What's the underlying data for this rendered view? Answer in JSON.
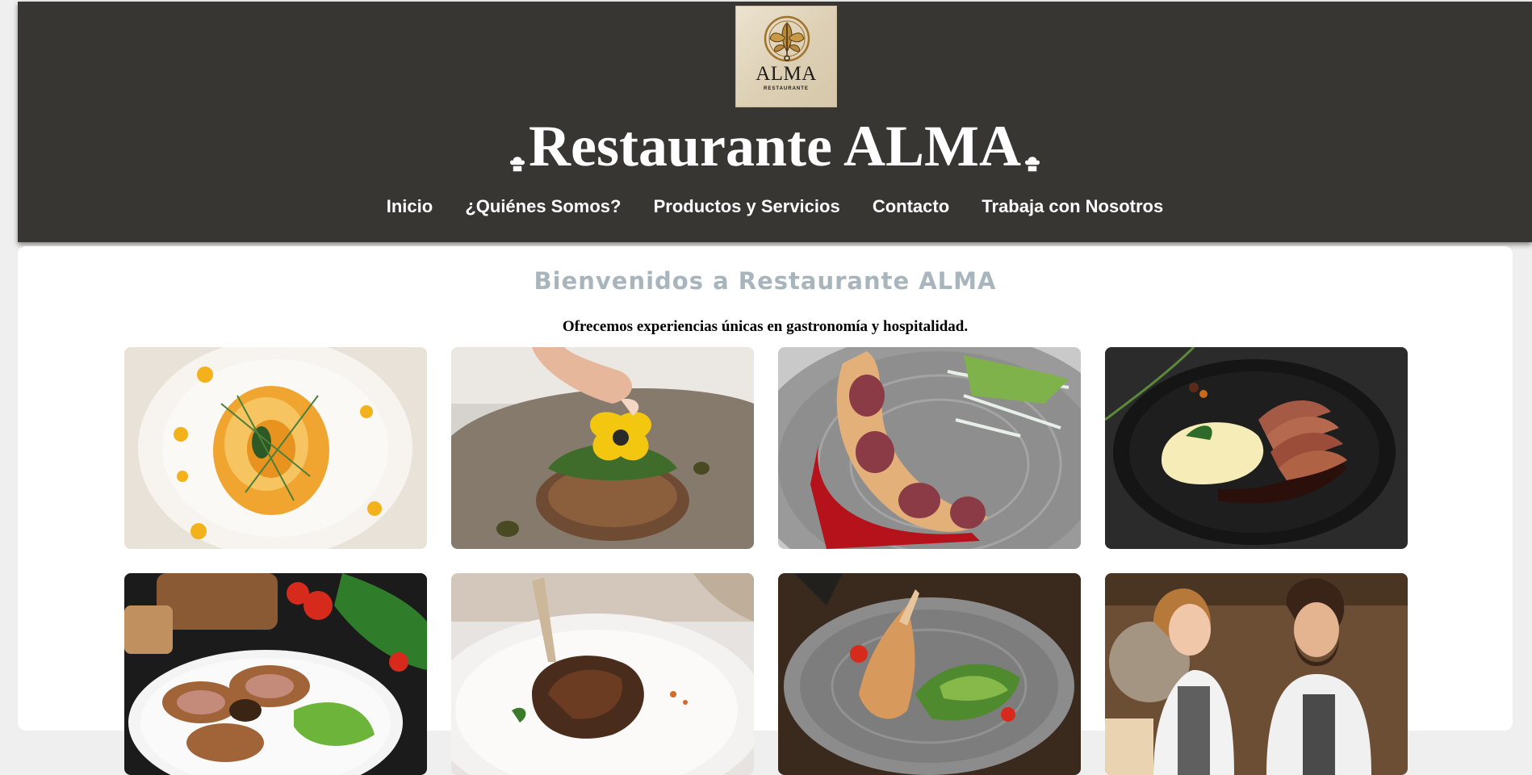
{
  "header": {
    "logo": {
      "name": "ALMA",
      "sub": "RESTAURANTE"
    },
    "title": "Restaurante ALMA",
    "nav": [
      "Inicio",
      "¿Quiénes Somos?",
      "Productos y Servicios",
      "Contacto",
      "Trabaja con Nosotros"
    ]
  },
  "main": {
    "heading": "Bienvenidos a Restaurante ALMA",
    "tagline": "Ofrecemos experiencias únicas en gastronomía y hospitalidad."
  },
  "gallery": [
    "pasta-dish-photo",
    "tartare-with-flower-photo",
    "stuffed-roulade-photo",
    "duck-breast-puree-photo",
    "meat-roll-salad-photo",
    "lamb-shank-photo",
    "roast-chicken-salad-photo",
    "chefs-team-photo"
  ],
  "colors": {
    "header_bg": "#383633",
    "heading": "#a9b5bc",
    "page_bg": "#efefef"
  }
}
